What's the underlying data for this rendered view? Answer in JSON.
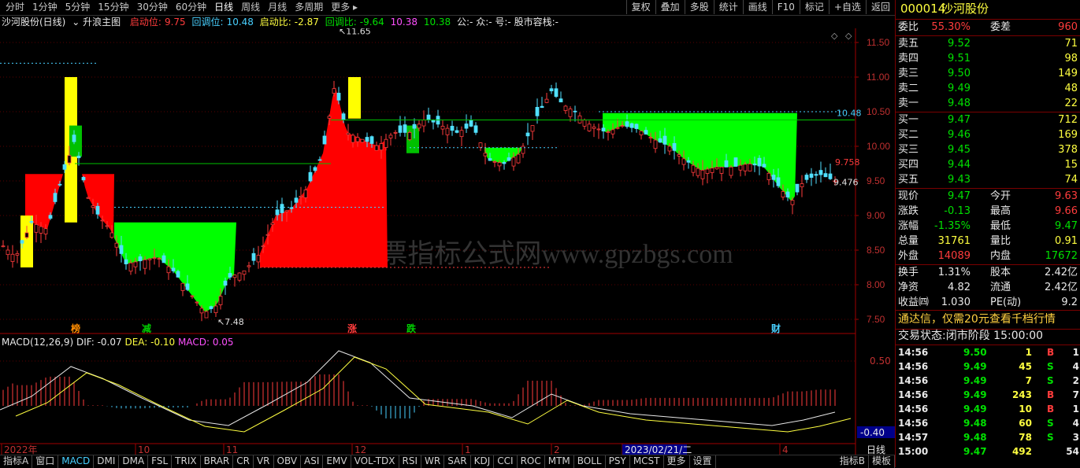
{
  "toolbar": {
    "periods": [
      "分时",
      "1分钟",
      "5分钟",
      "15分钟",
      "30分钟",
      "60分钟",
      "日线",
      "周线",
      "月线",
      "多周期",
      "更多 ▸"
    ],
    "active_period": "日线",
    "tools": [
      "复权",
      "叠加",
      "多股",
      "统计",
      "画线",
      "F10",
      "标记",
      "+自选",
      "返回"
    ]
  },
  "info": {
    "stock": "沙河股份(日线)",
    "indicator": "升浪主图",
    "qidong_label": "启动位:",
    "qidong": "9.75",
    "huitiao_label": "回调位:",
    "huitiao": "10.48",
    "qidongbi_label": "启动比:",
    "qidongbi": "-2.87",
    "huitiaobi_label": "回调比:",
    "huitiaobi": "-9.64",
    "v1": "10.38",
    "v2": "10.38",
    "tail": "公:- 众:- 号:- 股市容栈:-"
  },
  "price_axis": [
    "11.50",
    "11.00",
    "10.50",
    "10.00",
    "9.50",
    "9.00",
    "8.50",
    "8.00",
    "7.50"
  ],
  "annotations": {
    "high": "11.65",
    "low": "7.48",
    "right_high": "10.48",
    "right_a": "9.758",
    "right_b": "9.476"
  },
  "markers": [
    "榜",
    "减",
    "涨",
    "跌",
    "财"
  ],
  "watermark": "股票指标公式网www.gpzbgs.com",
  "macd": {
    "title": "MACD(12,26,9)",
    "dif": "DIF: -0.07",
    "dea": "DEA: -0.10",
    "macd": "MACD: 0.05",
    "axis_top": "0.50",
    "axis_val": "-0.40"
  },
  "time_axis": [
    "2022年",
    "10",
    "11",
    "12",
    "1",
    "2",
    "2023/02/21/二",
    "4"
  ],
  "time_axis_right": "日线",
  "bottom_tabs": [
    "指标A",
    "窗口",
    "MACD",
    "DMI",
    "DMA",
    "FSL",
    "TRIX",
    "BRAR",
    "CR",
    "VR",
    "OBV",
    "ASI",
    "EMV",
    "VOL-TDX",
    "RSI",
    "WR",
    "SAR",
    "KDJ",
    "CCI",
    "ROC",
    "MTM",
    "BOLL",
    "PSY",
    "MCST",
    "更多",
    "设置"
  ],
  "bottom_right_tabs": [
    "指标B",
    "模板"
  ],
  "active_tab": "MACD",
  "quote": {
    "code": "000014",
    "name": "沙河股份",
    "weibi_label": "委比",
    "weibi": "55.30%",
    "weicha_label": "委差",
    "weicha": "960",
    "sell": [
      {
        "label": "卖五",
        "price": "9.52",
        "vol": "71"
      },
      {
        "label": "卖四",
        "price": "9.51",
        "vol": "98"
      },
      {
        "label": "卖三",
        "price": "9.50",
        "vol": "149"
      },
      {
        "label": "卖二",
        "price": "9.49",
        "vol": "48"
      },
      {
        "label": "卖一",
        "price": "9.48",
        "vol": "22"
      }
    ],
    "buy": [
      {
        "label": "买一",
        "price": "9.47",
        "vol": "712"
      },
      {
        "label": "买二",
        "price": "9.46",
        "vol": "169"
      },
      {
        "label": "买三",
        "price": "9.45",
        "vol": "378"
      },
      {
        "label": "买四",
        "price": "9.44",
        "vol": "15"
      },
      {
        "label": "买五",
        "price": "9.43",
        "vol": "74"
      }
    ],
    "stats": [
      {
        "l1": "现价",
        "v1": "9.47",
        "l2": "今开",
        "v2": "9.63"
      },
      {
        "l1": "涨跌",
        "v1": "-0.13",
        "l2": "最高",
        "v2": "9.66"
      },
      {
        "l1": "涨幅",
        "v1": "-1.35%",
        "l2": "最低",
        "v2": "9.47"
      },
      {
        "l1": "总量",
        "v1": "31761",
        "l2": "量比",
        "v2": "0.91"
      },
      {
        "l1": "外盘",
        "v1": "14089",
        "l2": "内盘",
        "v2": "17672"
      }
    ],
    "stats2": [
      {
        "l1": "换手",
        "v1": "1.31%",
        "l2": "股本",
        "v2": "2.42亿"
      },
      {
        "l1": "净资",
        "v1": "4.82",
        "l2": "流通",
        "v2": "2.42亿"
      },
      {
        "l1": "收益㈣",
        "v1": "1.030",
        "l2": "PE(动)",
        "v2": "9.2"
      }
    ],
    "ad": "通达信，仅需20元查看千档行情",
    "status": "交易状态:闭市阶段 15:00:00",
    "ticks": [
      {
        "t": "14:56",
        "p": "9.50",
        "v": "1",
        "bs": "B",
        "n": "1"
      },
      {
        "t": "14:56",
        "p": "9.49",
        "v": "45",
        "bs": "S",
        "n": "4"
      },
      {
        "t": "14:56",
        "p": "9.49",
        "v": "7",
        "bs": "S",
        "n": "2"
      },
      {
        "t": "14:56",
        "p": "9.49",
        "v": "243",
        "bs": "B",
        "n": "7"
      },
      {
        "t": "14:56",
        "p": "9.49",
        "v": "10",
        "bs": "B",
        "n": "1"
      },
      {
        "t": "14:56",
        "p": "9.48",
        "v": "60",
        "bs": "S",
        "n": "4"
      },
      {
        "t": "14:57",
        "p": "9.48",
        "v": "78",
        "bs": "S",
        "n": "3"
      },
      {
        "t": "15:00",
        "p": "9.47",
        "v": "492",
        "bs": "",
        "n": "54"
      }
    ]
  },
  "colors": {
    "up": "#ff3c3c",
    "down": "#00ff00",
    "bg": "#000000",
    "axis": "#7a0000"
  }
}
